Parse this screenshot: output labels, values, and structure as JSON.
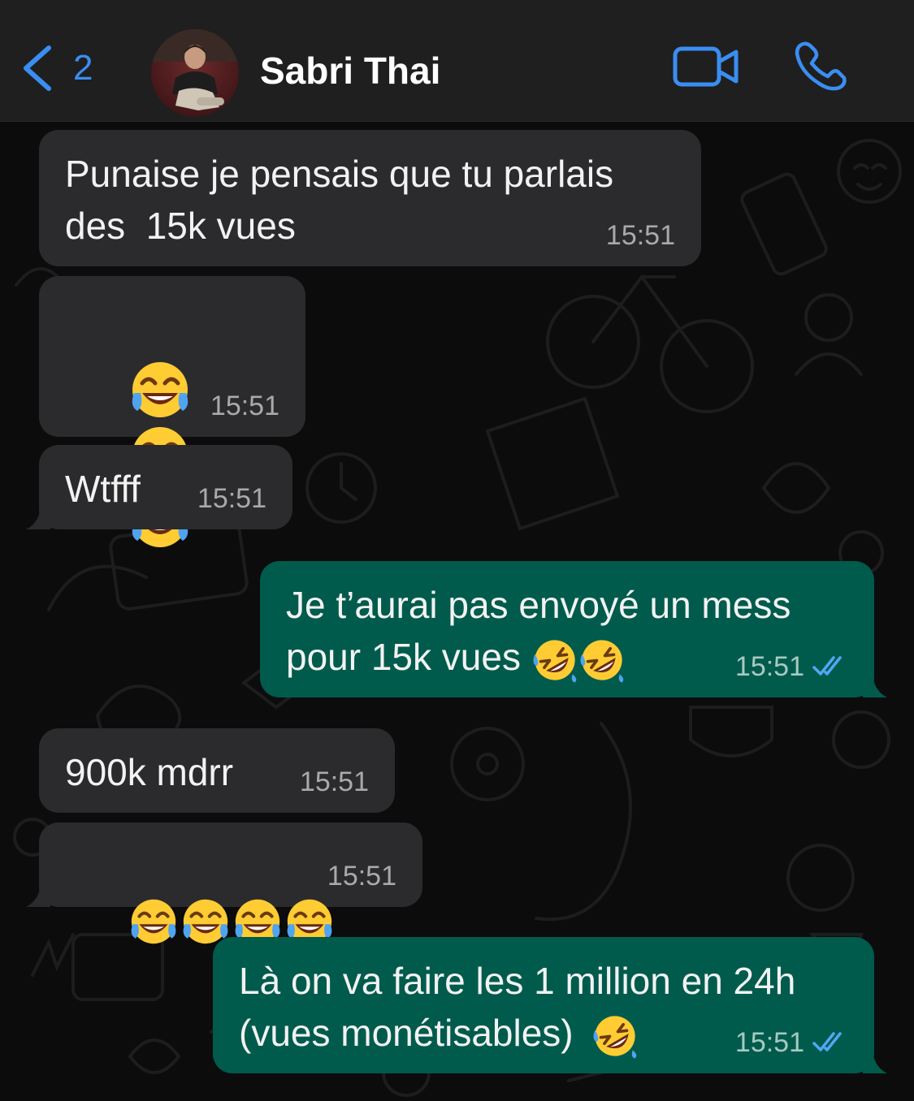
{
  "header": {
    "back_count": "2",
    "contact_name": "Sabri Thai",
    "icons": {
      "back": "chevron-left-icon",
      "video": "video-camera-icon",
      "call": "phone-icon"
    },
    "accent_color": "#3a8ef2"
  },
  "colors": {
    "incoming_bubble": "#2b2b2d",
    "outgoing_bubble": "#005b4c",
    "chat_background": "#0c0c0c",
    "read_ticks": "#53a6f5"
  },
  "messages": [
    {
      "direction": "in",
      "text": "Punaise je pensais que tu parlais\ndes  15k vues",
      "time": "15:51"
    },
    {
      "direction": "in",
      "text": "",
      "emojis": [
        "joy",
        "joy",
        "joy"
      ],
      "time": "15:51"
    },
    {
      "direction": "in",
      "text": "Wtfff",
      "time": "15:51"
    },
    {
      "direction": "out",
      "text": "Je t’aurai pas envoyé un mess\npour 15k vues",
      "emojis": [
        "rofl",
        "rofl"
      ],
      "time": "15:51",
      "status": "read"
    },
    {
      "direction": "in",
      "text": "900k mdrr",
      "time": "15:51"
    },
    {
      "direction": "in",
      "text": "",
      "emojis": [
        "joy",
        "joy",
        "joy",
        "joy"
      ],
      "time": "15:51"
    },
    {
      "direction": "out",
      "text": "Là on va faire les 1 million en 24h\n(vues monétisables)",
      "emojis": [
        "rofl"
      ],
      "time": "15:51",
      "status": "read"
    }
  ]
}
